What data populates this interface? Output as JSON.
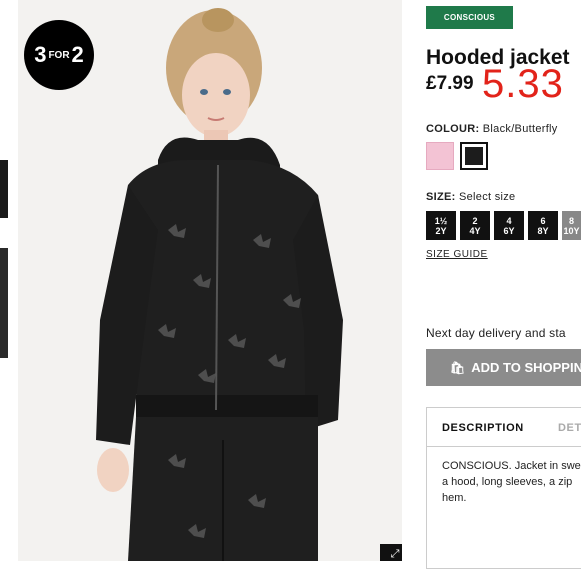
{
  "promo": {
    "big_left": "3",
    "small": "FOR",
    "big_right": "2"
  },
  "expand": {
    "icon": "expand-icon",
    "glyph": "⤢"
  },
  "product": {
    "badge": "CONSCIOUS",
    "title": "Hooded jacket",
    "price": "£7.99",
    "sale_price": "5.33",
    "colour_label": "COLOUR:",
    "colour_value": "Black/Butterfly",
    "size_label": "SIZE:",
    "size_value": "Select size",
    "sizes": [
      {
        "top": "1½",
        "bottom": "2Y"
      },
      {
        "top": "2",
        "bottom": "4Y"
      },
      {
        "top": "4",
        "bottom": "6Y"
      },
      {
        "top": "6",
        "bottom": "8Y"
      },
      {
        "top": "8",
        "bottom": "10Y"
      }
    ],
    "size_guide": "SIZE GUIDE",
    "delivery": "Next day delivery and sta",
    "add_to_bag": "ADD TO SHOPPING",
    "tabs": {
      "description": "DESCRIPTION",
      "details": "DET"
    },
    "description_text": "CONSCIOUS. Jacket in swe a hood, long sleeves, a zip hem."
  },
  "colors": {
    "badge_green": "#1f7a4a",
    "sale_red": "#e2231a",
    "swatch_pink": "#f3c3d4"
  }
}
